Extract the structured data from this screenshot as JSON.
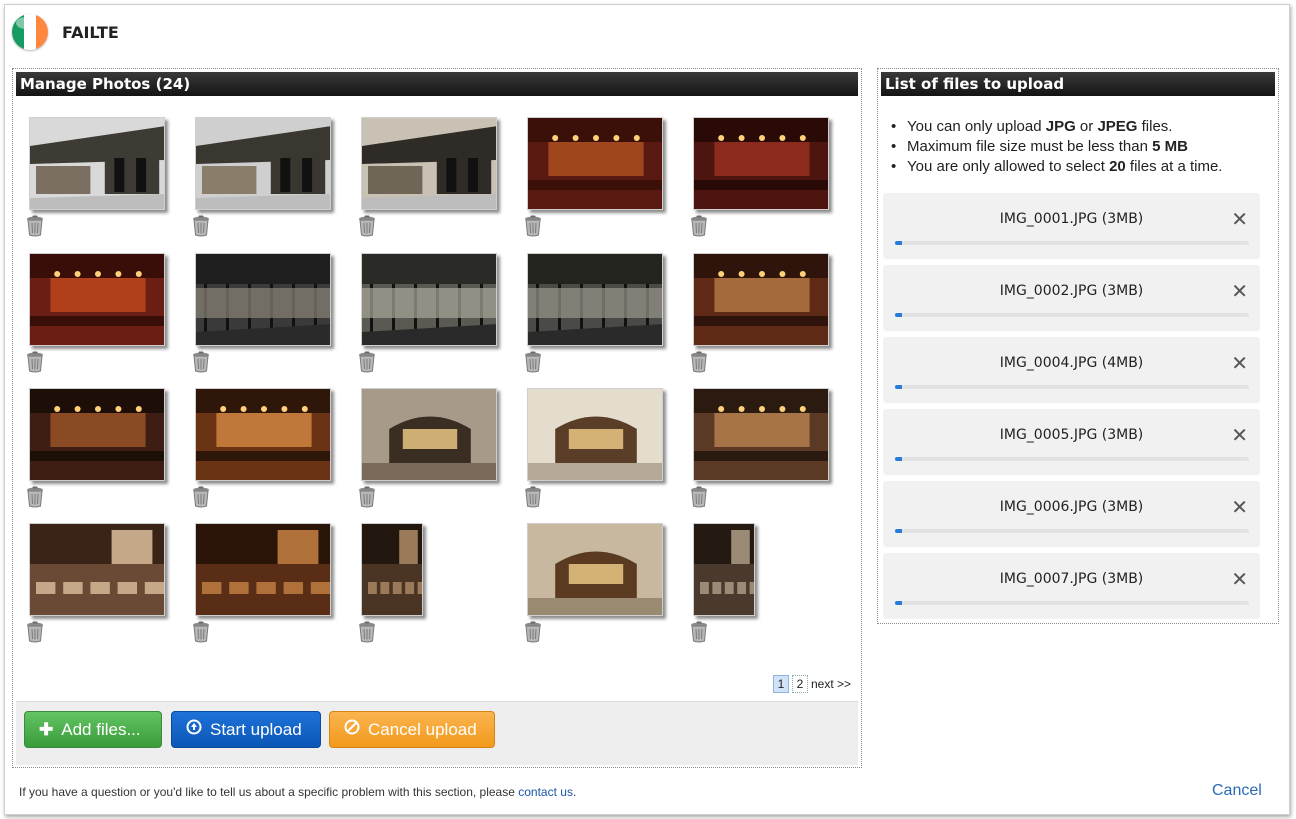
{
  "header": {
    "brand": "FAILTE",
    "flag_colors": [
      "#169b62",
      "#ffffff",
      "#ff883e"
    ]
  },
  "manage": {
    "title": "Manage Photos (24)",
    "photos": [
      {
        "scene": "exterior",
        "tone": [
          "#d9d9d9",
          "#3e3a34",
          "#7a6f60"
        ]
      },
      {
        "scene": "exterior",
        "tone": [
          "#cfcfcf",
          "#3a3630",
          "#8a7d6a"
        ]
      },
      {
        "scene": "exterior",
        "tone": [
          "#c9c2b4",
          "#2f2c28",
          "#6f6657"
        ]
      },
      {
        "scene": "bar",
        "tone": [
          "#5a1a12",
          "#a0461c",
          "#3a1008"
        ]
      },
      {
        "scene": "bar",
        "tone": [
          "#4e1410",
          "#8c2a1c",
          "#2a0a06"
        ]
      },
      {
        "scene": "bar",
        "tone": [
          "#6a1e14",
          "#b0401c",
          "#3a0e08"
        ]
      },
      {
        "scene": "terrace",
        "tone": [
          "#3a3a3a",
          "#8a8478",
          "#1e1e1e"
        ]
      },
      {
        "scene": "terrace",
        "tone": [
          "#5a5a52",
          "#aaa69a",
          "#2a2a26"
        ]
      },
      {
        "scene": "terrace",
        "tone": [
          "#4a4a46",
          "#9a968c",
          "#24241f"
        ]
      },
      {
        "scene": "bar",
        "tone": [
          "#5e2a16",
          "#a46a3c",
          "#2e140a"
        ]
      },
      {
        "scene": "bar",
        "tone": [
          "#3e1e12",
          "#8a4a24",
          "#1e0e08"
        ]
      },
      {
        "scene": "bar",
        "tone": [
          "#6a3414",
          "#c0783a",
          "#2e1608"
        ]
      },
      {
        "scene": "stone",
        "tone": [
          "#7a6a5a",
          "#3a2e22",
          "#a89a88"
        ]
      },
      {
        "scene": "stone",
        "tone": [
          "#b6a896",
          "#5a3e28",
          "#e4dccc"
        ]
      },
      {
        "scene": "bar",
        "tone": [
          "#5a3a24",
          "#a67446",
          "#2a1a10"
        ]
      },
      {
        "scene": "dining",
        "tone": [
          "#6a4a34",
          "#c4a888",
          "#3a2418"
        ]
      },
      {
        "scene": "dining",
        "tone": [
          "#5a2e16",
          "#b0703a",
          "#2a1408"
        ]
      },
      {
        "scene": "dining",
        "tone": [
          "#4a3424",
          "#9a7a58",
          "#221810"
        ]
      },
      {
        "scene": "stone",
        "tone": [
          "#9a8a72",
          "#5a3a20",
          "#c8b8a0"
        ]
      },
      {
        "scene": "dining",
        "tone": [
          "#4a3a2e",
          "#9a8a76",
          "#241a12"
        ]
      }
    ],
    "pager": {
      "pages": [
        "1",
        "2"
      ],
      "current": "1",
      "next_label": "next >>"
    },
    "buttons": {
      "add_label": "Add files...",
      "add_icon": "plus-icon",
      "start_label": "Start upload",
      "start_icon": "upload-circle-icon",
      "cancel_label": "Cancel upload",
      "cancel_icon": "ban-icon"
    }
  },
  "upload": {
    "title": "List of files to upload",
    "rules": [
      {
        "pre": "You can only upload ",
        "b1": "JPG",
        "mid": " or ",
        "b2": "JPEG",
        "post": " files."
      },
      {
        "pre": "Maximum file size must be less than ",
        "b1": "5 MB",
        "mid": "",
        "b2": "",
        "post": ""
      },
      {
        "pre": "You are only allowed to select ",
        "b1": "20",
        "mid": "",
        "b2": "",
        "post": " files at a time."
      }
    ],
    "files": [
      {
        "name": "IMG_0001.JPG (3MB)",
        "progress": 0.01
      },
      {
        "name": "IMG_0002.JPG (3MB)",
        "progress": 0.01
      },
      {
        "name": "IMG_0004.JPG (4MB)",
        "progress": 0.01
      },
      {
        "name": "IMG_0005.JPG (3MB)",
        "progress": 0.01
      },
      {
        "name": "IMG_0006.JPG (3MB)",
        "progress": 0.01
      },
      {
        "name": "IMG_0007.JPG (3MB)",
        "progress": 0.01
      }
    ],
    "remove_icon": "close-icon"
  },
  "footer": {
    "text": "If you have a question or you'd like to tell us about a specific problem with this section, please ",
    "link": "contact us",
    "end": ".",
    "cancel": "Cancel"
  }
}
